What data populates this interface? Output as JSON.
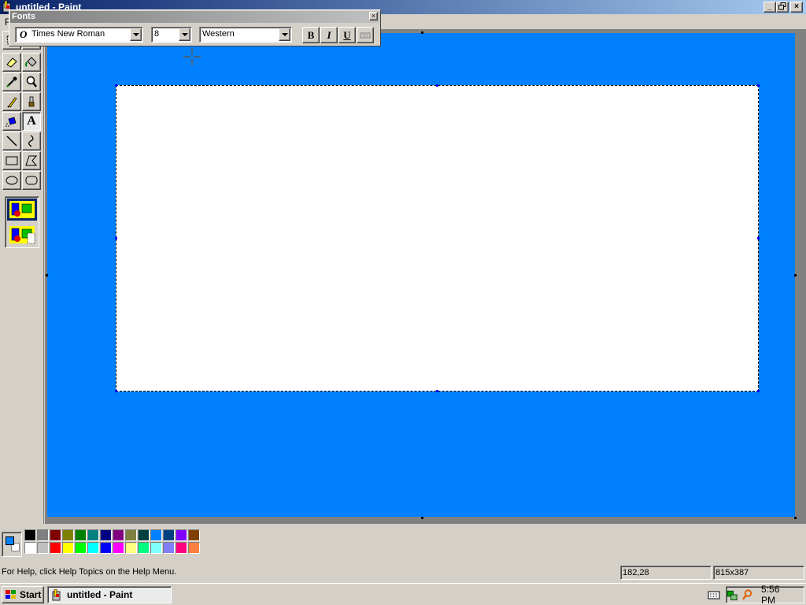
{
  "window": {
    "title": "untitled - Paint",
    "icon": "paint-icon",
    "caption_buttons": [
      "minimize-icon",
      "restore-icon",
      "close-icon"
    ]
  },
  "menubar": {
    "items": [
      {
        "label": "F"
      }
    ]
  },
  "fonts_toolbar": {
    "title": "Fonts",
    "font_name": "Times New Roman",
    "font_type_glyph": "O",
    "font_size": "8",
    "script": "Western",
    "bold_label": "B",
    "italic_label": "I",
    "underline_label": "U",
    "vertical_icon": "vertical-text-icon"
  },
  "tools": [
    {
      "name": "free-form-select",
      "icon": "free-select-icon"
    },
    {
      "name": "select",
      "icon": "select-icon"
    },
    {
      "name": "eraser",
      "icon": "eraser-icon"
    },
    {
      "name": "fill",
      "icon": "fill-bucket-icon"
    },
    {
      "name": "pick-color",
      "icon": "eyedropper-icon"
    },
    {
      "name": "magnifier",
      "icon": "magnifier-icon"
    },
    {
      "name": "pencil",
      "icon": "pencil-icon"
    },
    {
      "name": "brush",
      "icon": "brush-icon"
    },
    {
      "name": "airbrush",
      "icon": "airbrush-icon"
    },
    {
      "name": "text",
      "icon": "text-tool-icon",
      "label": "A",
      "selected": true
    },
    {
      "name": "line",
      "icon": "line-icon"
    },
    {
      "name": "curve",
      "icon": "curve-icon"
    },
    {
      "name": "rectangle",
      "icon": "rectangle-icon"
    },
    {
      "name": "polygon",
      "icon": "polygon-icon"
    },
    {
      "name": "ellipse",
      "icon": "ellipse-icon"
    },
    {
      "name": "rounded-rectangle",
      "icon": "rounded-rectangle-icon"
    }
  ],
  "tool_options": {
    "opaque_icon": "opaque-background-icon",
    "transparent_icon": "transparent-background-icon",
    "selected": "opaque"
  },
  "colors": {
    "canvas_background": "#0080ff",
    "foreground": "#0080ff",
    "background": "#ffffff",
    "text_frame": "#ffffff",
    "palette_top": [
      "#000000",
      "#808080",
      "#800000",
      "#808000",
      "#008000",
      "#008080",
      "#000080",
      "#800080",
      "#808040",
      "#004040",
      "#0080ff",
      "#004080",
      "#8000ff",
      "#804000"
    ],
    "palette_bottom": [
      "#ffffff",
      "#c0c0c0",
      "#ff0000",
      "#ffff00",
      "#00ff00",
      "#00ffff",
      "#0000ff",
      "#ff00ff",
      "#ffff80",
      "#00ff80",
      "#80ffff",
      "#8080ff",
      "#ff0080",
      "#ff8040"
    ]
  },
  "statusbar": {
    "help": "For Help, click Help Topics on the Help Menu.",
    "cursor_pos": "182,28",
    "selection_size": "815x387"
  },
  "taskbar": {
    "start_label": "Start",
    "task_label": "untitled - Paint",
    "clock": "5:56 PM",
    "tray_icons": [
      "keyboard-icon",
      "network-icon",
      "search-icon"
    ]
  }
}
